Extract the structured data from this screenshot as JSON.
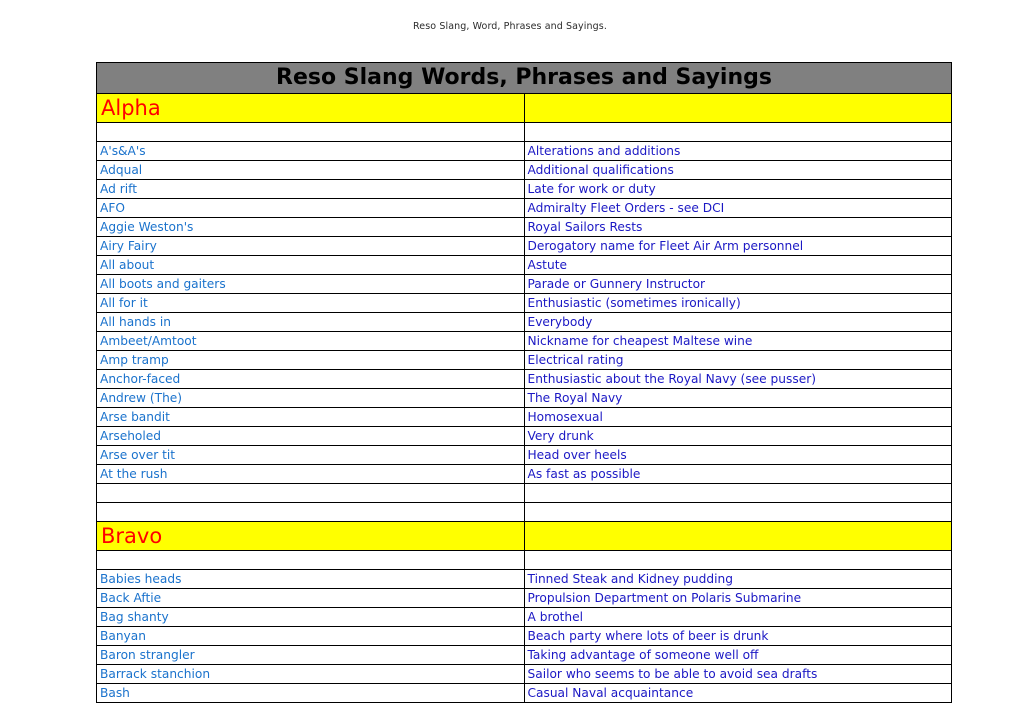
{
  "document": {
    "header_text": "Reso Slang, Word, Phrases and Sayings.",
    "table_title": "Reso Slang Words, Phrases and Sayings"
  },
  "colors": {
    "title_background": "#808080",
    "letter_background": "#ffff00",
    "letter_text": "#ff0000",
    "term_text": "#1a72cc",
    "definition_text": "#1b18c4",
    "border": "#000000",
    "page_background": "#ffffff"
  },
  "sections": [
    {
      "letter": "Alpha",
      "entries": [
        {
          "term": "A's&A's",
          "definition": "Alterations and additions"
        },
        {
          "term": "Adqual",
          "definition": "Additional qualifications"
        },
        {
          "term": "Ad rift",
          "definition": "Late for work or duty"
        },
        {
          "term": "AFO",
          "definition": "Admiralty Fleet Orders - see DCI"
        },
        {
          "term": "Aggie Weston's",
          "definition": "Royal Sailors Rests"
        },
        {
          "term": "Airy Fairy",
          "definition": "Derogatory name for Fleet Air Arm personnel"
        },
        {
          "term": "All about",
          "definition": "Astute"
        },
        {
          "term": "All boots and gaiters",
          "definition": "Parade or Gunnery Instructor"
        },
        {
          "term": "All for it",
          "definition": "Enthusiastic (sometimes ironically)"
        },
        {
          "term": "All hands in",
          "definition": "Everybody"
        },
        {
          "term": "Ambeet/Amtoot",
          "definition": "Nickname for cheapest Maltese wine"
        },
        {
          "term": "Amp tramp",
          "definition": "Electrical rating"
        },
        {
          "term": "Anchor-faced",
          "definition": "Enthusiastic about the Royal Navy (see pusser)"
        },
        {
          "term": "Andrew (The)",
          "definition": "The Royal Navy"
        },
        {
          "term": "Arse bandit",
          "definition": "Homosexual"
        },
        {
          "term": "Arseholed",
          "definition": "Very drunk"
        },
        {
          "term": "Arse over tit",
          "definition": "Head over heels"
        },
        {
          "term": "At the rush",
          "definition": "As fast as possible"
        }
      ]
    },
    {
      "letter": "Bravo",
      "entries": [
        {
          "term": "Babies heads",
          "definition": "Tinned Steak and Kidney pudding"
        },
        {
          "term": "Back Aftie",
          "definition": "Propulsion Department on Polaris Submarine"
        },
        {
          "term": "Bag shanty",
          "definition": "A brothel"
        },
        {
          "term": "Banyan",
          "definition": "Beach party where lots of beer is drunk"
        },
        {
          "term": "Baron strangler",
          "definition": "Taking advantage of someone well off"
        },
        {
          "term": "Barrack stanchion",
          "definition": "Sailor who seems to be able to avoid sea drafts"
        },
        {
          "term": "Bash",
          "definition": "Casual Naval acquaintance"
        }
      ]
    }
  ]
}
